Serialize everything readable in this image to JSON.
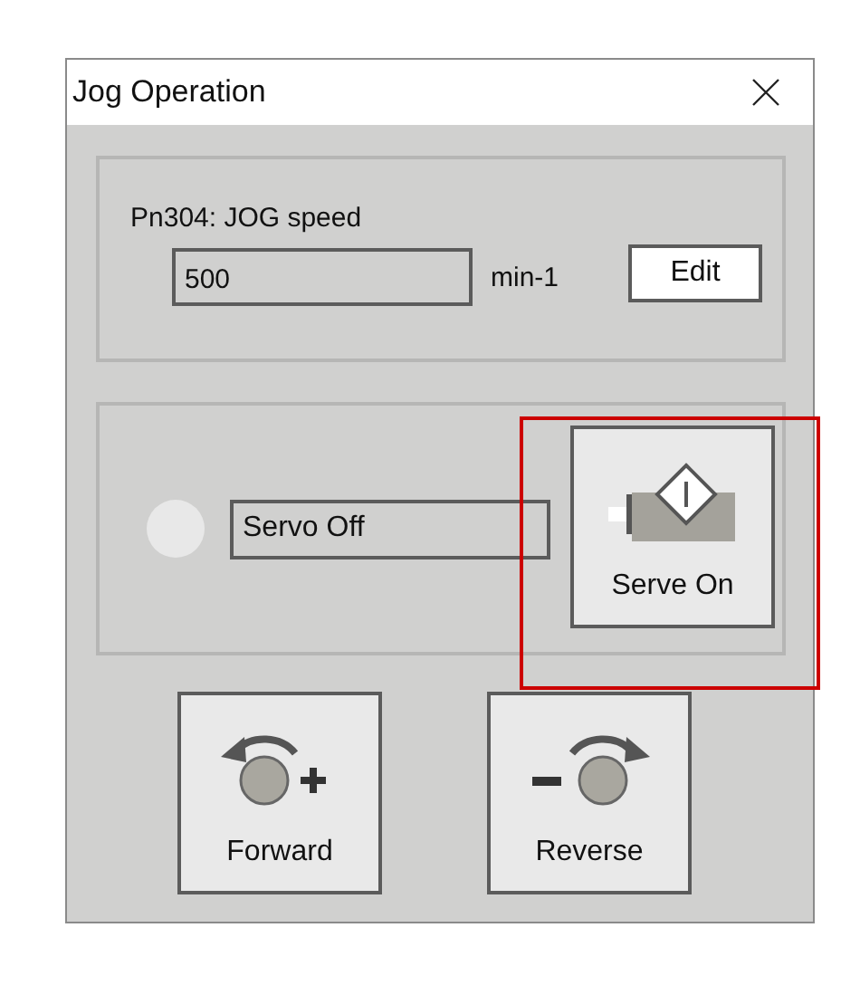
{
  "window": {
    "title": "Jog Operation"
  },
  "jog_speed": {
    "label": "Pn304: JOG speed",
    "value": "500",
    "unit": "min-1",
    "edit_button": "Edit"
  },
  "servo": {
    "lamp_on": false,
    "status": "Servo Off",
    "button": {
      "label": "Serve On",
      "highlighted": true
    }
  },
  "jog_buttons": [
    {
      "kind": "forward",
      "label": "Forward"
    },
    {
      "kind": "reverse",
      "label": "Reverse"
    }
  ]
}
